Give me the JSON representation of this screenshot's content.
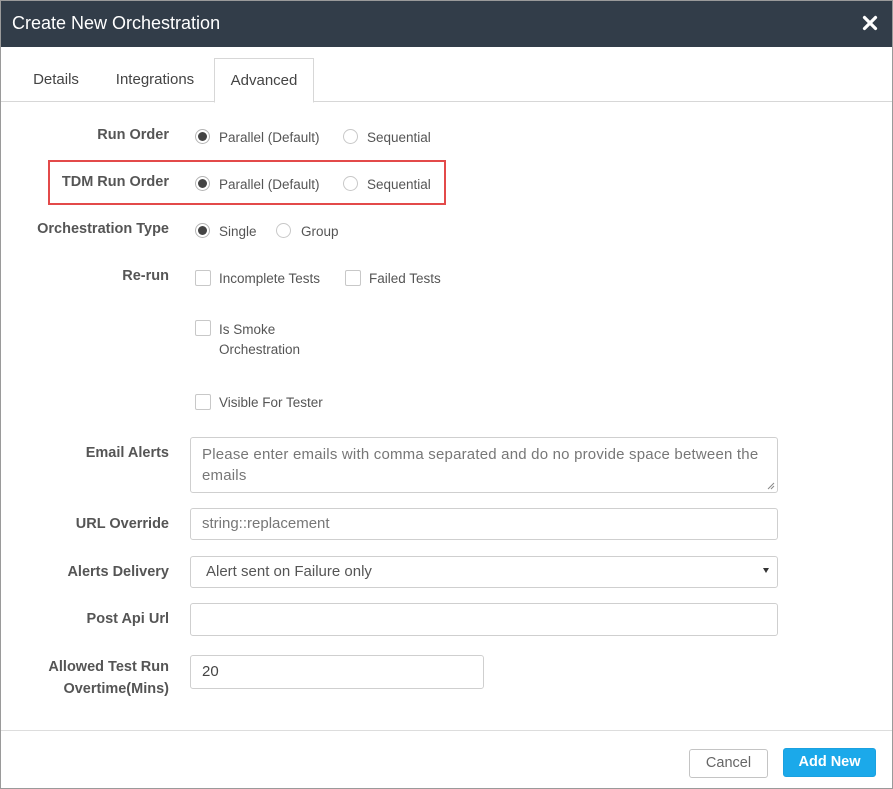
{
  "modal": {
    "title": "Create New Orchestration"
  },
  "tabs": [
    {
      "label": "Details"
    },
    {
      "label": "Integrations"
    },
    {
      "label": "Advanced"
    }
  ],
  "form": {
    "run_order": {
      "label": "Run Order",
      "options": [
        "Parallel (Default)",
        "Sequential"
      ],
      "selected": "Parallel (Default)"
    },
    "tdm_run_order": {
      "label": "TDM Run Order",
      "options": [
        "Parallel (Default)",
        "Sequential"
      ],
      "selected": "Parallel (Default)",
      "highlight_color": "#e34a4a"
    },
    "orchestration_type": {
      "label": "Orchestration Type",
      "options": [
        "Single",
        "Group"
      ],
      "selected": "Single"
    },
    "rerun": {
      "label": "Re-run",
      "checkboxes": [
        "Incomplete Tests",
        "Failed Tests"
      ]
    },
    "is_smoke": {
      "line1": "Is Smoke",
      "line2": "Orchestration"
    },
    "visible_for_tester": "Visible For Tester",
    "email_alerts": {
      "label": "Email Alerts",
      "placeholder": "Please enter emails with comma separated and do no provide space between the emails"
    },
    "url_override": {
      "label": "URL Override",
      "placeholder": "string::replacement"
    },
    "alerts_delivery": {
      "label": "Alerts Delivery",
      "value": "Alert sent on Failure only"
    },
    "post_api_url": {
      "label": "Post Api Url",
      "value": ""
    },
    "allowed_overtime": {
      "label_line1": "Allowed Test Run",
      "label_line2": "Overtime(Mins)",
      "value": "20"
    }
  },
  "footer": {
    "cancel_label": "Cancel",
    "add_label": "Add New"
  },
  "colors": {
    "titlebar": "#323d49",
    "primary_button": "#1ba9ea"
  },
  "icons": {
    "close": "close-icon",
    "select": "chevron-down-icon",
    "resize": "resize-grip-icon"
  }
}
